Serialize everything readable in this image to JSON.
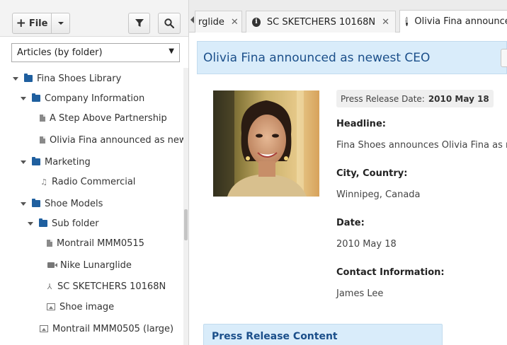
{
  "toolbar": {
    "file_label": "File",
    "icons": [
      "plus-icon",
      "caret-down-icon",
      "filter-icon",
      "search-icon"
    ]
  },
  "view_select": {
    "value": "Articles (by folder)"
  },
  "tree": [
    {
      "label": "Fina Shoes Library",
      "type": "folder",
      "depth": 0,
      "expanded": true
    },
    {
      "label": "Company Information",
      "type": "folder",
      "depth": 1,
      "expanded": true
    },
    {
      "label": "A Step Above Partnership",
      "type": "document",
      "depth": 2
    },
    {
      "label": "Olivia Fina announced as newest CEO",
      "type": "document",
      "depth": 2
    },
    {
      "label": "Marketing",
      "type": "folder",
      "depth": 1,
      "expanded": true
    },
    {
      "label": "Radio Commercial",
      "type": "audio",
      "depth": 2
    },
    {
      "label": "Shoe Models",
      "type": "folder",
      "depth": 1,
      "expanded": true
    },
    {
      "label": "Sub folder",
      "type": "folder",
      "depth": 2,
      "expanded": true
    },
    {
      "label": "Montrail MMM0515",
      "type": "document",
      "depth": 3
    },
    {
      "label": "Nike Lunarglide",
      "type": "video",
      "depth": 3
    },
    {
      "label": "SC SKETCHERS 10168N",
      "type": "pdf",
      "depth": 3
    },
    {
      "label": "Shoe image",
      "type": "image",
      "depth": 3
    },
    {
      "label": "Montrail MMM0505 (large)",
      "type": "image",
      "depth": 2
    }
  ],
  "tabs": [
    {
      "label": "Nike Lunarglide",
      "visible_label": "rglide",
      "active": false
    },
    {
      "label": "SC SKETCHERS 10168N",
      "active": false
    },
    {
      "label": "Olivia Fina announced as newest CEO",
      "active": true
    }
  ],
  "article": {
    "title": "Olivia Fina announced as newest CEO",
    "press_date_label": "Press Release Date:",
    "press_date_value": "2010 May 18",
    "headline_label": "Headline:",
    "headline_value": "Fina Shoes announces Olivia Fina as newest CEO",
    "city_label": "City, Country:",
    "city_value": "Winnipeg, Canada",
    "date_label": "Date:",
    "date_value": "2010 May 18",
    "contact_label": "Contact Information:",
    "contact_value": "James Lee",
    "content_section_label": "Press Release Content"
  },
  "colors": {
    "accent": "#1b4f8a",
    "panel_bg": "#d9ecfa",
    "folder_icon": "#1f5f9f"
  }
}
